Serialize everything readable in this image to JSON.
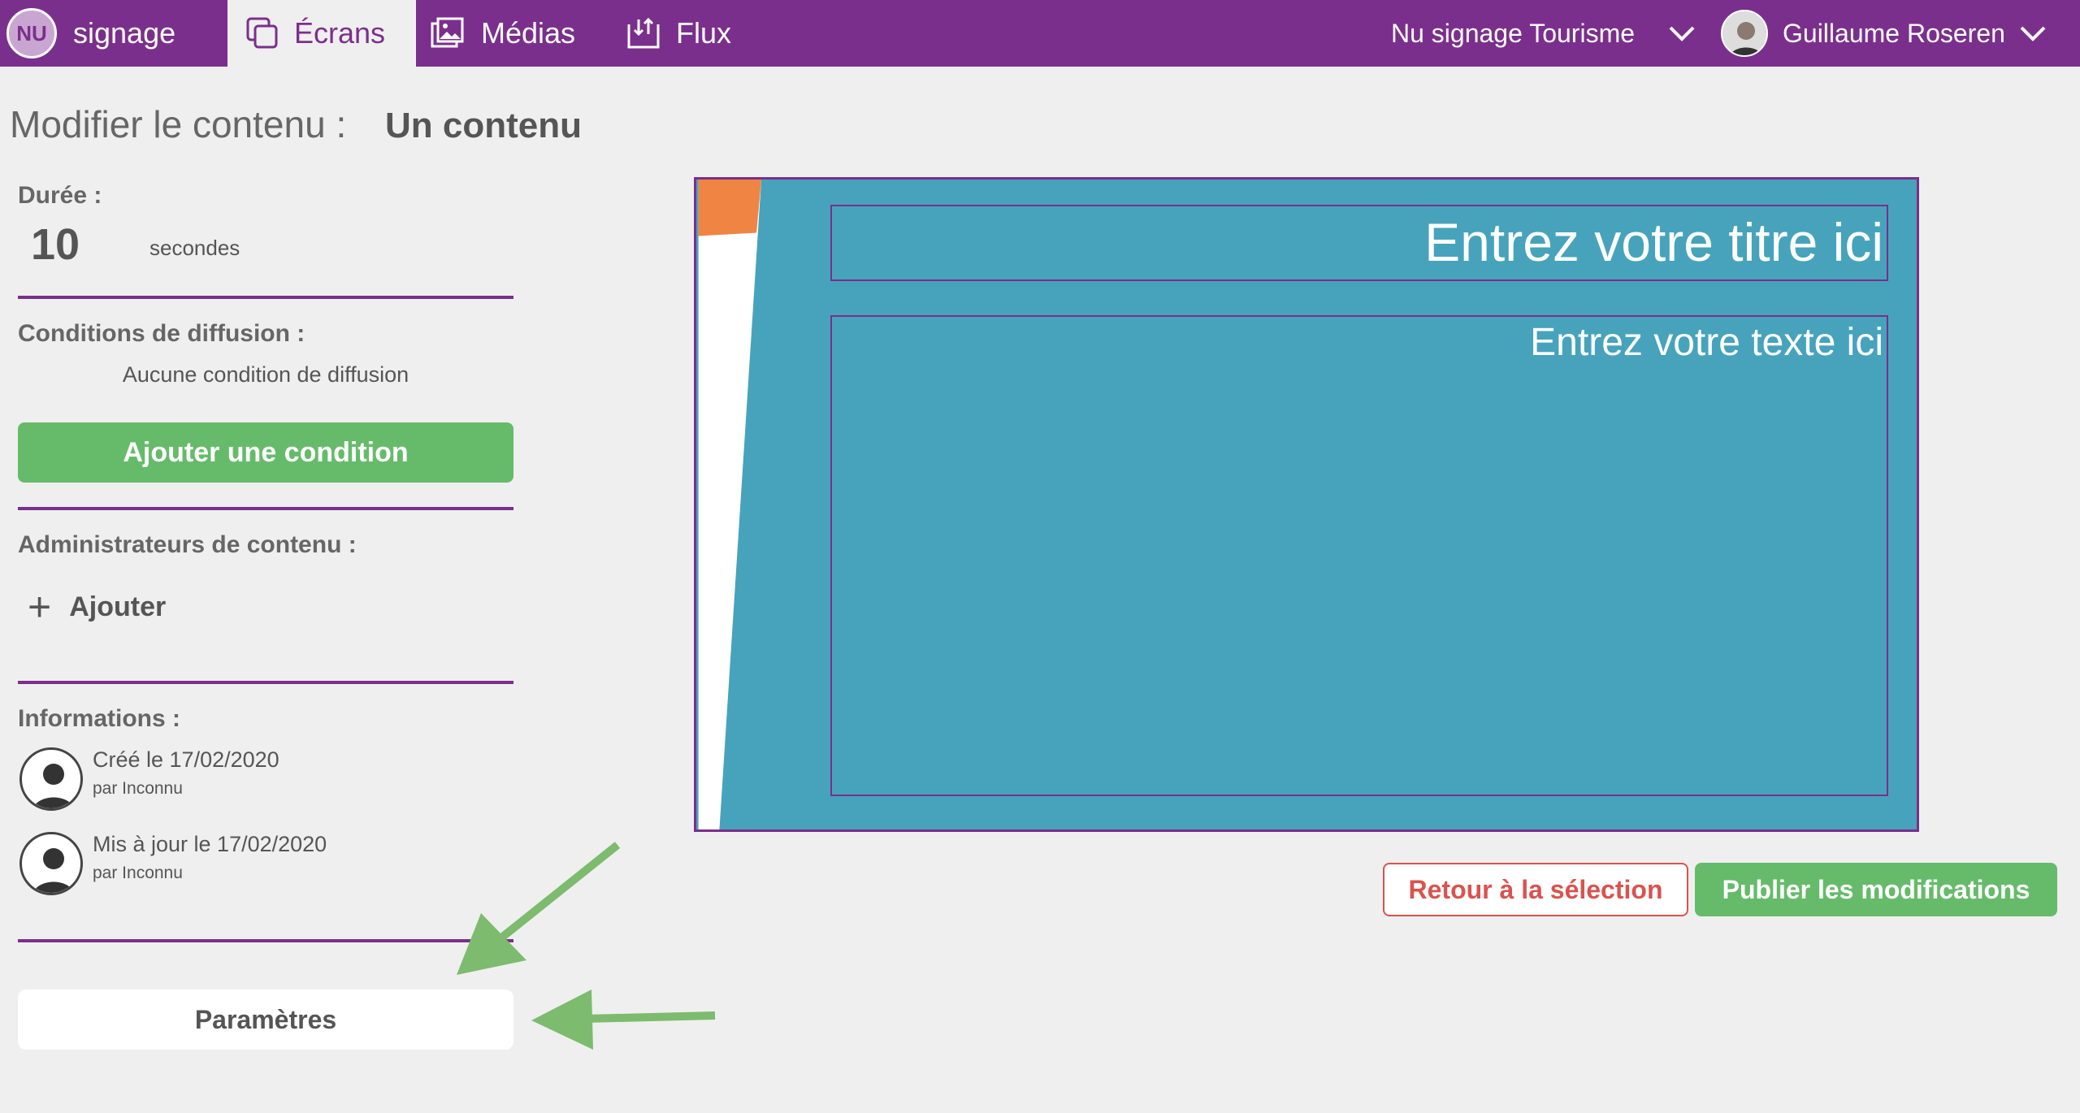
{
  "nav": {
    "brand_logo": "NU",
    "brand_text": "signage",
    "tabs": [
      {
        "label": "Écrans",
        "icon": "screens-icon",
        "active": true
      },
      {
        "label": "Médias",
        "icon": "media-icon",
        "active": false
      },
      {
        "label": "Flux",
        "icon": "flux-icon",
        "active": false
      }
    ],
    "organization": "Nu signage Tourisme",
    "user_name": "Guillaume Roseren"
  },
  "page": {
    "title_label": "Modifier le contenu :",
    "content_name": "Un contenu"
  },
  "duration": {
    "label": "Durée :",
    "value": "10",
    "unit": "secondes"
  },
  "conditions": {
    "label": "Conditions de diffusion :",
    "empty_text": "Aucune condition de diffusion",
    "add_button": "Ajouter une condition"
  },
  "admins": {
    "label": "Administrateurs de contenu :",
    "add_button": "Ajouter"
  },
  "informations": {
    "label": "Informations :",
    "created": "Créé le 17/02/2020",
    "created_by": "par Inconnu",
    "updated": "Mis à jour le 17/02/2020",
    "updated_by": "par Inconnu"
  },
  "params_button": "Paramètres",
  "preview": {
    "title_placeholder": "Entrez votre titre ici",
    "text_placeholder": "Entrez votre texte ici"
  },
  "actions": {
    "back_button": "Retour à la sélection",
    "publish_button": "Publier les modifications"
  },
  "colors": {
    "brand": "#7b2f8c",
    "accent_green": "#66bb6a",
    "danger": "#d9534f",
    "preview_bg": "#47a3bb",
    "annotation_arrow": "#7dbb6e"
  }
}
